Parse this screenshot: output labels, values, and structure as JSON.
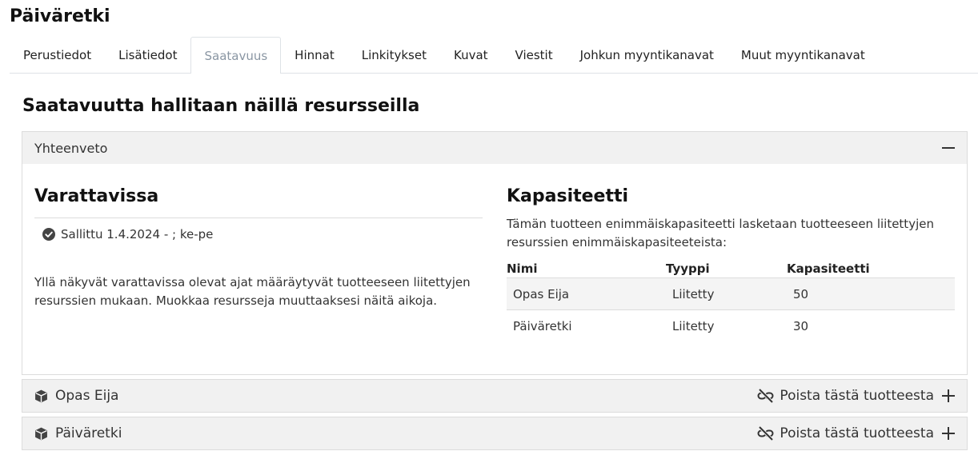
{
  "page": {
    "title": "Päiväretki"
  },
  "tabs": [
    {
      "label": "Perustiedot"
    },
    {
      "label": "Lisätiedot"
    },
    {
      "label": "Saatavuus",
      "active": true
    },
    {
      "label": "Hinnat"
    },
    {
      "label": "Linkitykset"
    },
    {
      "label": "Kuvat"
    },
    {
      "label": "Viestit"
    },
    {
      "label": "Johkun myyntikanavat"
    },
    {
      "label": "Muut myyntikanavat"
    }
  ],
  "section": {
    "title": "Saatavuutta hallitaan näillä resursseilla"
  },
  "summary": {
    "header": "Yhteenveto",
    "collapse_icon": "minus-icon",
    "bookable": {
      "title": "Varattavissa",
      "allowed_text": "Sallittu 1.4.2024 - ; ke-pe",
      "allowed_icon": "check-circle-icon",
      "note": "Yllä näkyvät varattavissa olevat ajat määräytyvät tuotteeseen liitettyjen resurssien mukaan. Muokkaa resursseja muuttaaksesi näitä aikoja."
    },
    "capacity": {
      "title": "Kapasiteetti",
      "description": "Tämän tuotteen enimmäiskapasiteetti lasketaan tuotteeseen liitettyjen resurssien enimmäiskapasiteeteista:",
      "columns": [
        "Nimi",
        "Tyyppi",
        "Kapasiteetti"
      ],
      "rows": [
        {
          "name": "Opas Eija",
          "type": "Liitetty",
          "capacity": "50"
        },
        {
          "name": "Päiväretki",
          "type": "Liitetty",
          "capacity": "30"
        }
      ]
    }
  },
  "resources": [
    {
      "name": "Opas Eija",
      "icon": "cube-icon",
      "remove_label": "Poista tästä tuotteesta",
      "remove_icon": "unlink-icon",
      "expand_icon": "plus-icon"
    },
    {
      "name": "Päiväretki",
      "icon": "cube-icon",
      "remove_label": "Poista tästä tuotteesta",
      "remove_icon": "unlink-icon",
      "expand_icon": "plus-icon"
    }
  ],
  "colors": {
    "active_tab_text": "#8a96a3",
    "card_header_bg": "#f1f1f1",
    "border": "#dcdcdc"
  }
}
